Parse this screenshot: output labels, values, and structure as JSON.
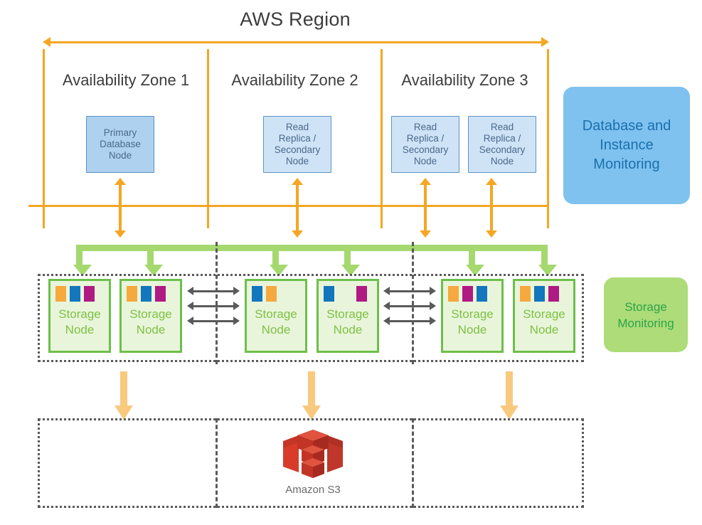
{
  "region": {
    "title": "AWS Region",
    "span_arrow": "bidirectional-arrow",
    "accent_color": "#F5A623"
  },
  "availability_zones": [
    {
      "label": "Availability Zone 1"
    },
    {
      "label": "Availability Zone 2"
    },
    {
      "label": "Availability Zone 3"
    }
  ],
  "database_nodes": [
    {
      "label": "Primary\nDatabase\nNode",
      "line1": "Primary",
      "line2": "Database",
      "line3": "Node",
      "zone": 1,
      "role": "primary"
    },
    {
      "label": "Read Replica / Secondary Node",
      "line1": "Read",
      "line2": "Replica /",
      "line3": "Secondary",
      "line4": "Node",
      "zone": 2,
      "role": "replica"
    },
    {
      "label": "Read Replica / Secondary Node",
      "line1": "Read",
      "line2": "Replica /",
      "line3": "Secondary",
      "line4": "Node",
      "zone": 3,
      "role": "replica"
    },
    {
      "label": "Read Replica / Secondary Node",
      "line1": "Read",
      "line2": "Replica /",
      "line3": "Secondary",
      "line4": "Node",
      "zone": 3,
      "role": "replica"
    }
  ],
  "callouts": {
    "database_monitoring": {
      "line1": "Database and",
      "line2": "Instance",
      "line3": "Monitoring",
      "fill": "#7FC2EF",
      "text_color": "#1A6FAF"
    },
    "storage_monitoring": {
      "line1": "Storage",
      "line2": "Monitoring",
      "fill": "#ADDC78",
      "text_color": "#2CA44A"
    }
  },
  "storage_nodes": [
    {
      "line1": "Storage",
      "line2": "Node",
      "chips": [
        "orange",
        "blue",
        "magenta"
      ],
      "zone": 1
    },
    {
      "line1": "Storage",
      "line2": "Node",
      "chips": [
        "orange",
        "blue",
        "magenta"
      ],
      "zone": 1
    },
    {
      "line1": "Storage",
      "line2": "Node",
      "chips": [
        "blue",
        "orange"
      ],
      "zone": 2
    },
    {
      "line1": "Storage",
      "line2": "Node",
      "chips": [
        "blue",
        "magenta"
      ],
      "zone": 2
    },
    {
      "line1": "Storage",
      "line2": "Node",
      "chips": [
        "orange",
        "magenta",
        "blue"
      ],
      "zone": 3
    },
    {
      "line1": "Storage",
      "line2": "Node",
      "chips": [
        "orange",
        "blue",
        "magenta"
      ],
      "zone": 3
    }
  ],
  "chip_colors": {
    "orange": "#F5A93F",
    "blue": "#1277BC",
    "magenta": "#B01A83"
  },
  "storage_layer": {
    "border_style": "dotted",
    "node_border": "#6CC04A",
    "node_fill": "#E9F5DB",
    "node_text": "#7DC242",
    "manifold_color": "#A5D86E",
    "cross_zone_arrows_per_gap": 3,
    "cross_zone_arrow_color": "#5a5a5a"
  },
  "backup_layer": {
    "service_label": "Amazon S3",
    "icon": "amazon-s3-bucket-icon",
    "icon_color": "#C8322A",
    "arrow_color": "#F9C97E",
    "arrow_count": 3
  }
}
